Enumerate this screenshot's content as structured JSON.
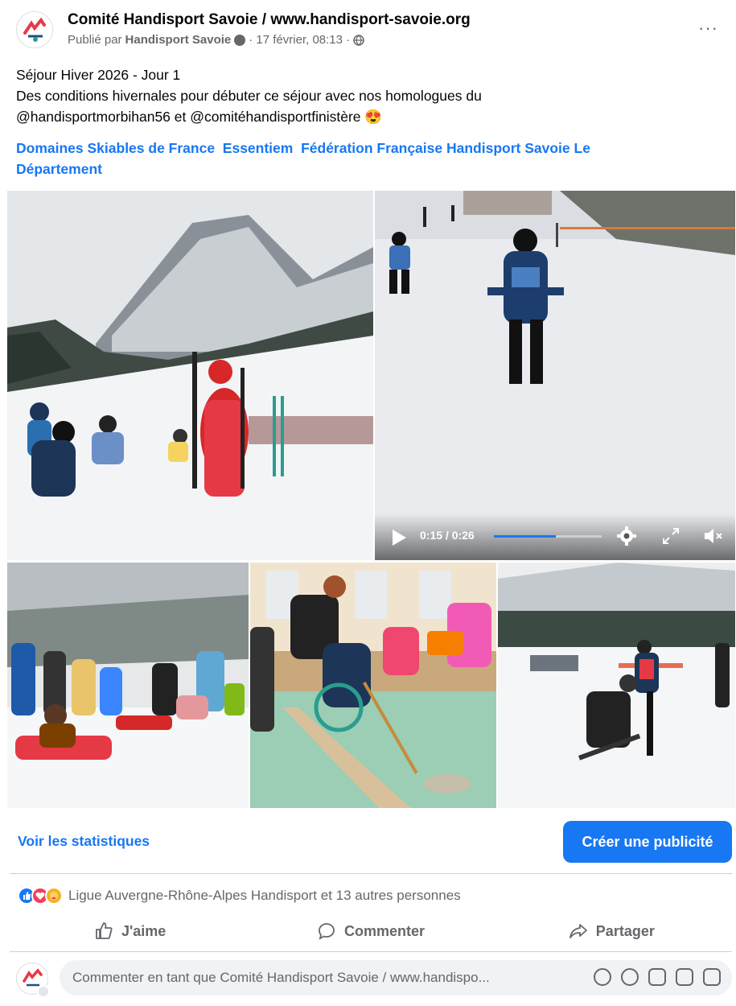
{
  "header": {
    "page_name": "Comité Handisport Savoie / www.handisport-savoie.org",
    "published_prefix": "Publié par",
    "published_by": "Handisport Savoie",
    "date": "· 17 février, 08:13 ·",
    "more_label": "···"
  },
  "post": {
    "title": "Séjour Hiver 2026 - Jour 1",
    "line1": "Des conditions hivernales pour débuter ce séjour avec nos homologues du",
    "line2": "@handisportmorbihan56 et @comitéhandisportfinistère 😍",
    "tags": [
      "Domaines Skiables de France",
      "Essentiem",
      "Fédération Française Handisport",
      "Savoie Le",
      "Département"
    ]
  },
  "video": {
    "time": "0:15 / 0:26",
    "progress": 0.577
  },
  "stats": {
    "view_stats": "Voir les statistiques",
    "create_ad": "Créer une publicité"
  },
  "reactions": {
    "text": "Ligue Auvergne-Rhône-Alpes Handisport et 13 autres personnes"
  },
  "actions": {
    "like": "J'aime",
    "comment": "Commenter",
    "share": "Partager"
  },
  "comment": {
    "placeholder": "Commenter en tant que Comité Handisport Savoie / www.handispo..."
  },
  "colors": {
    "accent": "#1877f2",
    "text_secondary": "#65676b"
  }
}
